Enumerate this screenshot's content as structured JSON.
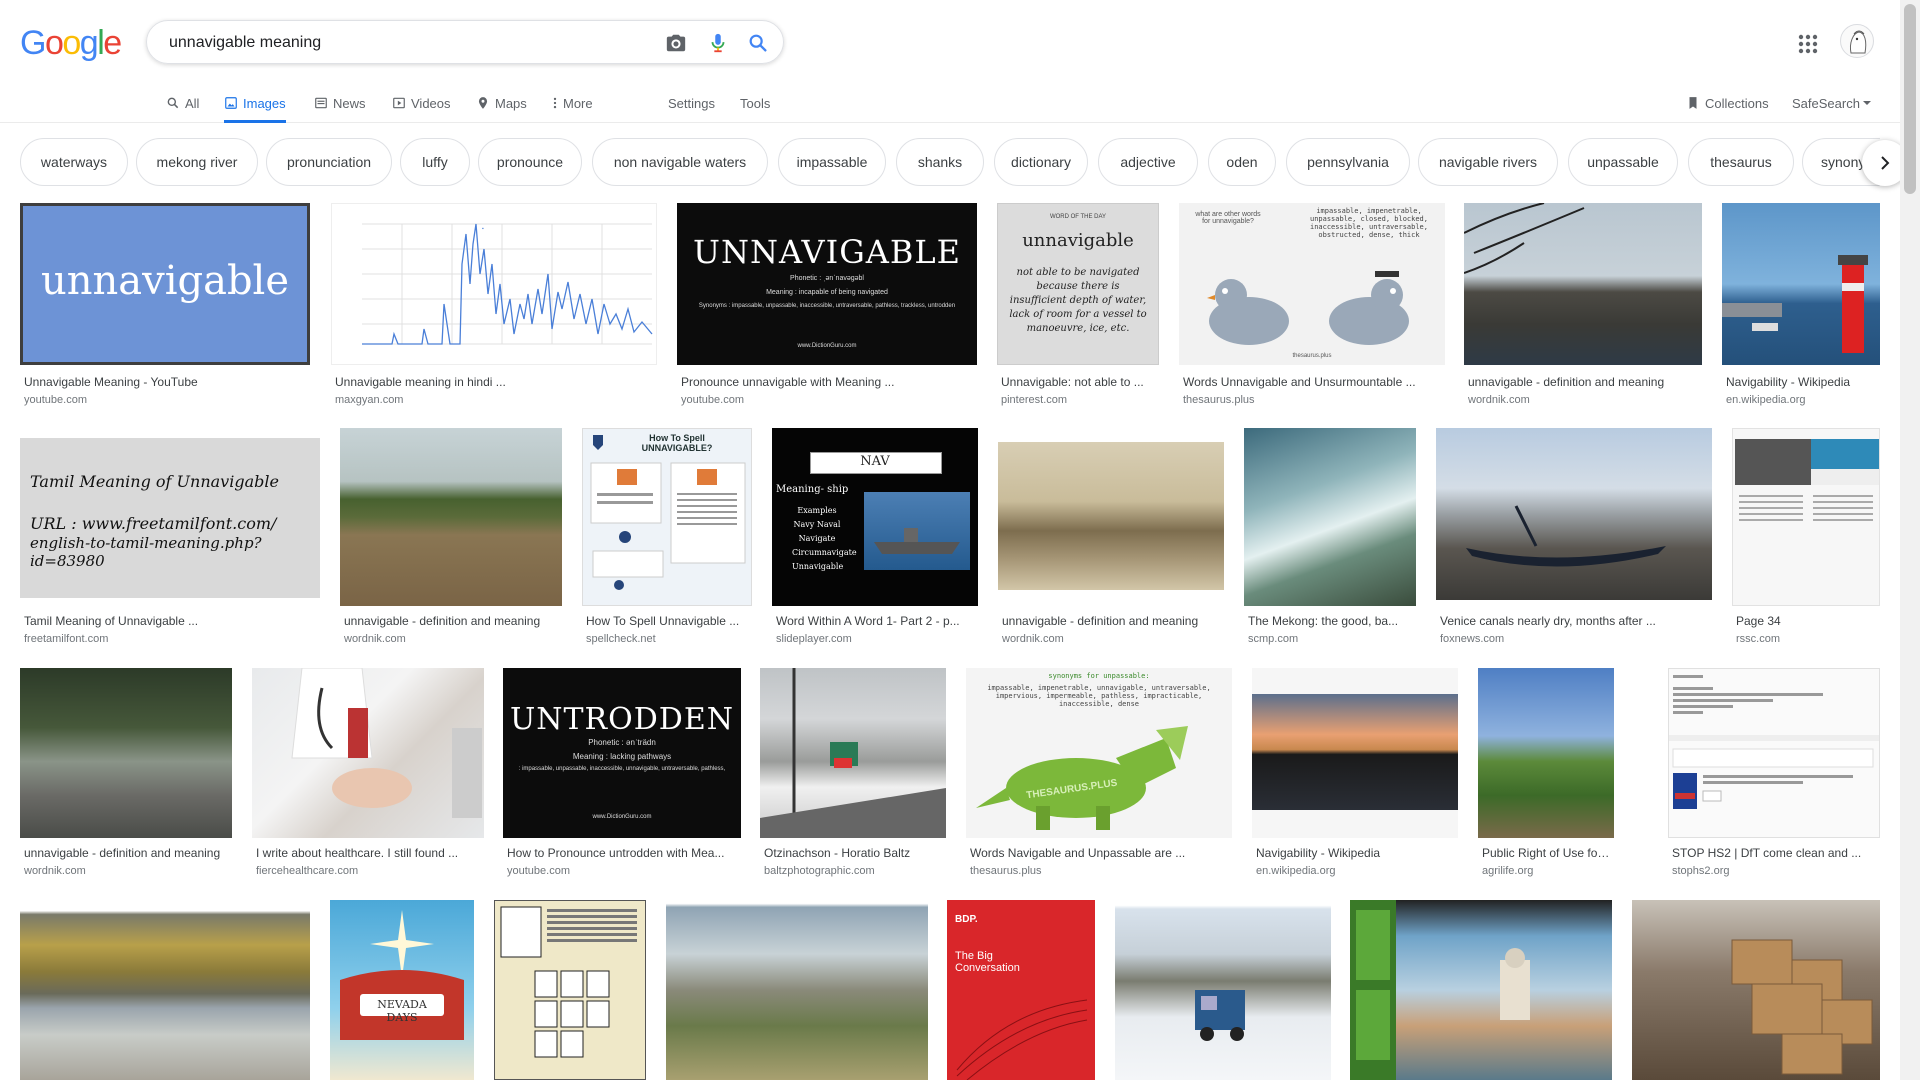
{
  "logo": {
    "letters": [
      "G",
      "o",
      "o",
      "g",
      "l",
      "e"
    ],
    "colors": [
      "#4285f4",
      "#ea4335",
      "#fbbc05",
      "#4285f4",
      "#34a853",
      "#ea4335"
    ]
  },
  "search": {
    "value": "unnavigable meaning",
    "placeholder": ""
  },
  "tabs": [
    {
      "label": "All",
      "icon": "search-icon"
    },
    {
      "label": "Images",
      "icon": "image-icon",
      "active": true
    },
    {
      "label": "News",
      "icon": "news-icon"
    },
    {
      "label": "Videos",
      "icon": "video-icon"
    },
    {
      "label": "Maps",
      "icon": "map-icon"
    },
    {
      "label": "More",
      "icon": "more-vert-icon"
    },
    {
      "label": "Settings"
    },
    {
      "label": "Tools"
    }
  ],
  "right_tools": {
    "collections": "Collections",
    "safesearch": "SafeSearch"
  },
  "chips": [
    "waterways",
    "mekong river",
    "pronunciation",
    "luffy",
    "pronounce",
    "non navigable waters",
    "impassable",
    "shanks",
    "dictionary",
    "adjective",
    "oden",
    "pennsylvania",
    "navigable rivers",
    "unpassable",
    "thesaurus",
    "synony"
  ],
  "thumb_text": {
    "r1_1": "unnavigable",
    "r1_3_title": "UNNAVIGABLE",
    "r1_3_phon": "Phonetic : ˌənˈnavəgəbl",
    "r1_3_mean": "Meaning : incapable of being navigated",
    "r1_3_syn": "Synonyms : impassable, unpassable, inaccessible, untraversable, pathless, trackless, untrodden",
    "r1_3_site": "www.DictionGuru.com",
    "r1_4_head": "WORD OF THE DAY",
    "r1_4_word": "unnavigable",
    "r1_4_def": "not able to be navigated because there is insufficient depth of water, lack of room for a vessel to manoeuvre, ice, etc.",
    "r1_5_q": "what are other words for unnavigable?",
    "r1_5_a": "impassable, impenetrable, unpassable, closed, blocked, inaccessible, untraversable, obstructed, dense, thick",
    "r1_5_site": "thesaurus.plus",
    "r2_1_a": "Tamil Meaning of Unnavigable",
    "r2_1_b": "URL : www.freetamilfont.com/",
    "r2_1_c": "english-to-tamil-meaning.php?id=83980",
    "r2_3_title": "How To Spell UNNAVIGABLE?",
    "r2_4_title": "NAV",
    "r2_4_list": "Meaning- ship",
    "r2_4_words": "Examples Navy Naval Navigate Circumnavigate Unnavigable",
    "r3_3_title": "UNTRODDEN",
    "r3_3_phon": "Phonetic : ənˈträdn",
    "r3_3_mean": "Meaning : lacking pathways",
    "r3_3_syn": ": impassable, unpassable, inaccessible, unnavigable, untraversable, pathless,",
    "r3_3_site": "www.DictionGuru.com",
    "r3_5_head": "synonyms for unpassable:",
    "r3_5_list": "impassable, impenetrable, unnavigable, untraversable, impervious, impermeable, pathless, impracticable, inaccessible, dense",
    "r3_5_brand": "THESAURUS.PLUS",
    "r4_2": "NEVADA DAYS",
    "r4_5_brand": "BDP.",
    "r4_5_title": "The Big Conversation"
  },
  "results": [
    {
      "caption": "Unnavigable Meaning - YouTube",
      "source": "youtube.com"
    },
    {
      "caption": "Unnavigable meaning in hindi ...",
      "source": "maxgyan.com"
    },
    {
      "caption": "Pronounce unnavigable with Meaning ...",
      "source": "youtube.com"
    },
    {
      "caption": "Unnavigable: not able to ...",
      "source": "pinterest.com"
    },
    {
      "caption": "Words Unnavigable and Unsurmountable ...",
      "source": "thesaurus.plus"
    },
    {
      "caption": "unnavigable - definition and meaning",
      "source": "wordnik.com"
    },
    {
      "caption": "Navigability - Wikipedia",
      "source": "en.wikipedia.org"
    },
    {
      "caption": "Tamil Meaning of Unnavigable ...",
      "source": "freetamilfont.com"
    },
    {
      "caption": "unnavigable - definition and meaning",
      "source": "wordnik.com"
    },
    {
      "caption": "How To Spell Unnavigable ...",
      "source": "spellcheck.net"
    },
    {
      "caption": "Word Within A Word 1- Part 2 - p...",
      "source": "slideplayer.com"
    },
    {
      "caption": "unnavigable - definition and meaning",
      "source": "wordnik.com"
    },
    {
      "caption": "The Mekong: the good, ba...",
      "source": "scmp.com"
    },
    {
      "caption": "Venice canals nearly dry, months after ...",
      "source": "foxnews.com"
    },
    {
      "caption": "Page 34",
      "source": "rssc.com"
    },
    {
      "caption": "unnavigable - definition and meaning",
      "source": "wordnik.com"
    },
    {
      "caption": "I write about healthcare. I still found ...",
      "source": "fiercehealthcare.com"
    },
    {
      "caption": "How to Pronounce untrodden with Mea...",
      "source": "youtube.com"
    },
    {
      "caption": "Otzinachson - Horatio Baltz",
      "source": "baltzphotographic.com"
    },
    {
      "caption": "Words Navigable and Unpassable are ...",
      "source": "thesaurus.plus"
    },
    {
      "caption": "Navigability - Wikipedia",
      "source": "en.wikipedia.org"
    },
    {
      "caption": "Public Right of Use for Tex...",
      "source": "agrilife.org"
    },
    {
      "caption": "STOP HS2 | DfT come clean and ...",
      "source": "stophs2.org"
    }
  ]
}
